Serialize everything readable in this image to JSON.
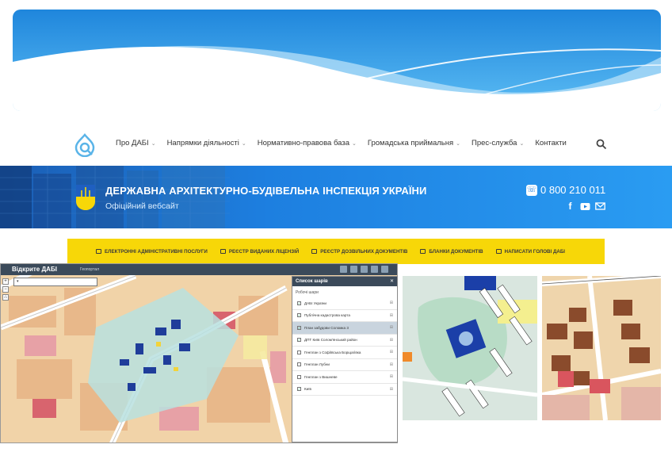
{
  "nav": {
    "items": [
      {
        "label": "Про ДАБІ",
        "dropdown": true
      },
      {
        "label": "Напрямки діяльності",
        "dropdown": true
      },
      {
        "label": "Нормативно-правова база",
        "dropdown": true
      },
      {
        "label": "Громадська приймальня",
        "dropdown": true
      },
      {
        "label": "Прес-служба",
        "dropdown": true
      },
      {
        "label": "Контакти",
        "dropdown": false
      }
    ],
    "search_icon": "search-icon"
  },
  "hero": {
    "title": "ДЕРЖАВНА АРХІТЕКТУРНО-БУДІВЕЛЬНА ІНСПЕКЦІЯ УКРАЇНИ",
    "subtitle": "Офіційний вебсайт",
    "phone": "0 800 210 011"
  },
  "services": [
    {
      "label": "ЕЛЕКТРОННІ АДМІНІСТРАТИВНІ ПОСЛУГИ",
      "icon": "monitor-icon"
    },
    {
      "label": "РЕЄСТР ВИДАНИХ ЛІЦЕНЗІЙ",
      "icon": "list-icon"
    },
    {
      "label": "РЕЄСТР ДОЗВІЛЬНИХ ДОКУМЕНТІВ",
      "icon": "document-icon"
    },
    {
      "label": "БЛАНКИ ДОКУМЕНТІВ",
      "icon": "copy-icon"
    },
    {
      "label": "НАПИСАТИ ГОЛОВІ ДАБІ",
      "icon": "mail-icon"
    }
  ],
  "map_app": {
    "title": "Відкрите ДАБІ",
    "geo_label": "Геопортал"
  },
  "layer_panel": {
    "title": "Список шарів",
    "section": "Робочі шари",
    "layers": [
      {
        "label": "ДАБІ України",
        "checked": true,
        "active": false
      },
      {
        "label": "Публічна кадастрова карта",
        "checked": true,
        "active": false
      },
      {
        "label": "План забудови Соломка 3",
        "checked": true,
        "active": true
      },
      {
        "label": "ДПТ Київ Солом'янський район",
        "checked": true,
        "active": false
      },
      {
        "label": "Генплан з Софіївська Борщагівка",
        "checked": false,
        "active": false
      },
      {
        "label": "Генплан Лубни",
        "checked": false,
        "active": false
      },
      {
        "label": "Генплан з Вишневе",
        "checked": false,
        "active": false
      },
      {
        "label": "Київ",
        "checked": true,
        "active": false
      }
    ]
  },
  "colors": {
    "hero_blue": "#1d7fe0",
    "service_yellow": "#f7d708",
    "map_header": "#3b4a5a"
  }
}
